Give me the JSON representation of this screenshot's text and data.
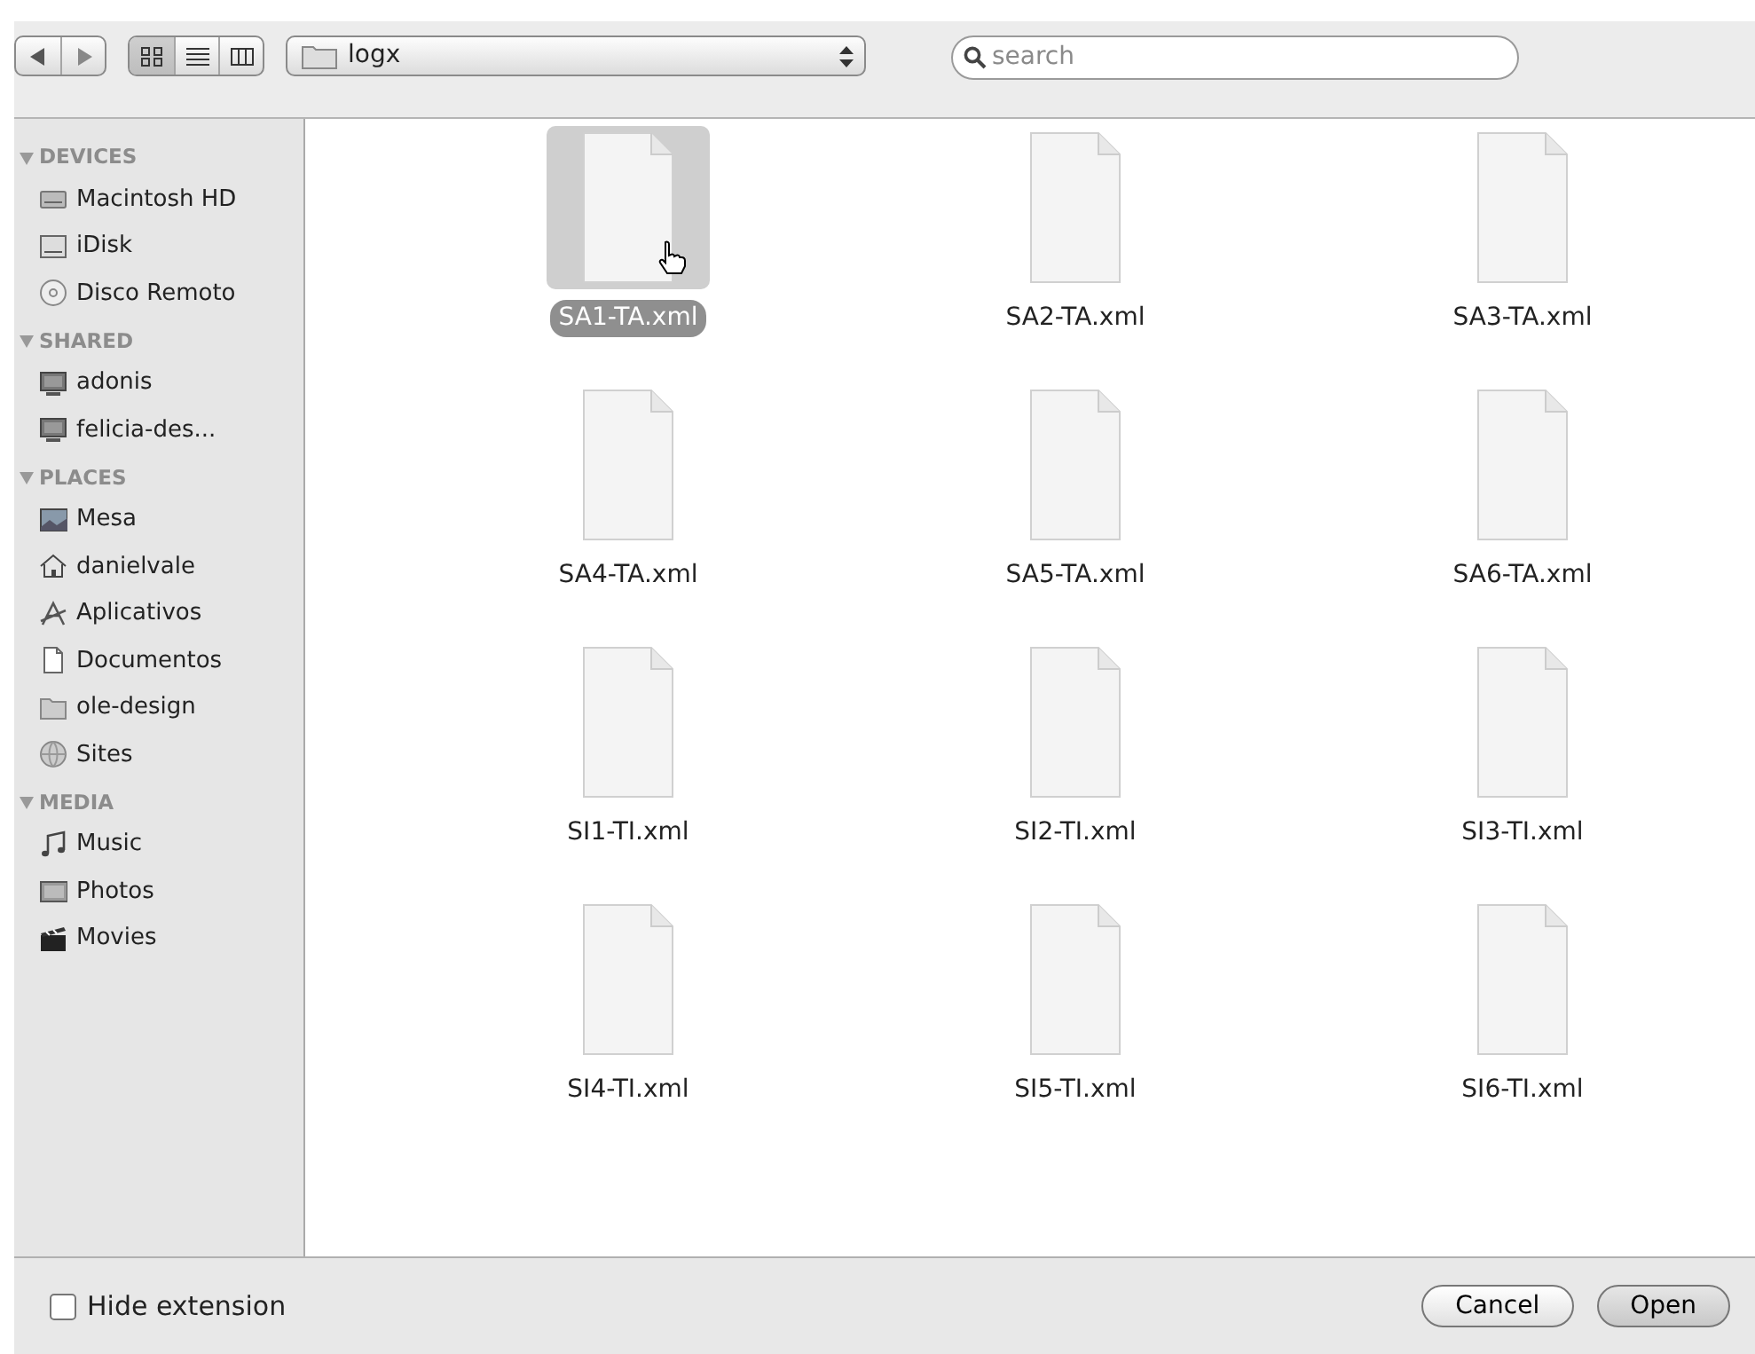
{
  "toolbar": {
    "path": "logx",
    "search": {
      "placeholder": "search"
    },
    "view_modes": [
      {
        "kind": "icons",
        "selected": true
      },
      {
        "kind": "list",
        "selected": false
      },
      {
        "kind": "columns",
        "selected": false
      }
    ]
  },
  "sidebar": {
    "sections": [
      {
        "title": "DEVICES",
        "expanded": true,
        "items": [
          {
            "kind": "harddisk",
            "label": "Macintosh HD"
          },
          {
            "kind": "idisk",
            "label": "iDisk"
          },
          {
            "kind": "disc",
            "label": "Disco Remoto"
          }
        ]
      },
      {
        "title": "SHARED",
        "expanded": true,
        "items": [
          {
            "kind": "computer",
            "label": "adonis"
          },
          {
            "kind": "computer",
            "label": "felicia-des..."
          }
        ]
      },
      {
        "title": "PLACES",
        "expanded": true,
        "items": [
          {
            "kind": "desktop",
            "label": "Mesa"
          },
          {
            "kind": "home",
            "label": "danielvale"
          },
          {
            "kind": "apps",
            "label": "Aplicativos"
          },
          {
            "kind": "document",
            "label": "Documentos"
          },
          {
            "kind": "folder",
            "label": "ole-design"
          },
          {
            "kind": "globe",
            "label": "Sites"
          }
        ]
      },
      {
        "title": "MEDIA",
        "expanded": true,
        "items": [
          {
            "kind": "music",
            "label": "Music"
          },
          {
            "kind": "photo",
            "label": "Photos"
          },
          {
            "kind": "movie",
            "label": "Movies"
          }
        ]
      }
    ]
  },
  "files": [
    {
      "name": "SA1-TA.xml",
      "selected": true
    },
    {
      "name": "SA2-TA.xml",
      "selected": false
    },
    {
      "name": "SA3-TA.xml",
      "selected": false
    },
    {
      "name": "SA4-TA.xml",
      "selected": false
    },
    {
      "name": "SA5-TA.xml",
      "selected": false
    },
    {
      "name": "SA6-TA.xml",
      "selected": false
    },
    {
      "name": "SI1-TI.xml",
      "selected": false
    },
    {
      "name": "SI2-TI.xml",
      "selected": false
    },
    {
      "name": "SI3-TI.xml",
      "selected": false
    },
    {
      "name": "SI4-TI.xml",
      "selected": false
    },
    {
      "name": "SI5-TI.xml",
      "selected": false
    },
    {
      "name": "SI6-TI.xml",
      "selected": false
    }
  ],
  "footer": {
    "hide_extension": {
      "label": "Hide extension",
      "checked": false
    },
    "buttons": [
      "Cancel",
      "Open"
    ]
  }
}
